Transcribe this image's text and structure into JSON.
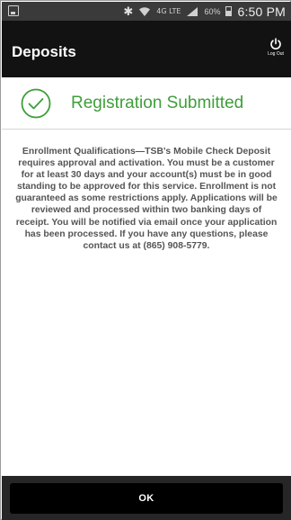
{
  "status_bar": {
    "network_label": "4G LTE",
    "battery_percent": "60%",
    "time": "6:50 PM",
    "icons": [
      "gallery-icon",
      "bluetooth-icon",
      "wifi-icon",
      "signal-icon",
      "battery-icon"
    ]
  },
  "header": {
    "title": "Deposits",
    "logout_label": "Log Out",
    "logout_icon": "power-icon"
  },
  "banner": {
    "icon": "check-circle-icon",
    "text": "Registration Submitted",
    "accent_color": "#3f9e3a"
  },
  "message": "Enrollment Qualifications—TSB's Mobile Check Deposit requires approval and activation. You must be a customer for at least 30 days and your account(s) must be in good standing to be approved for this service. Enrollment is not guaranteed as some restrictions apply. Applications will be reviewed and processed within two banking days of receipt. You will be notified via email once your application has been processed. If you have any questions, please contact us at (865) 908-5779.",
  "footer": {
    "ok_label": "OK"
  }
}
